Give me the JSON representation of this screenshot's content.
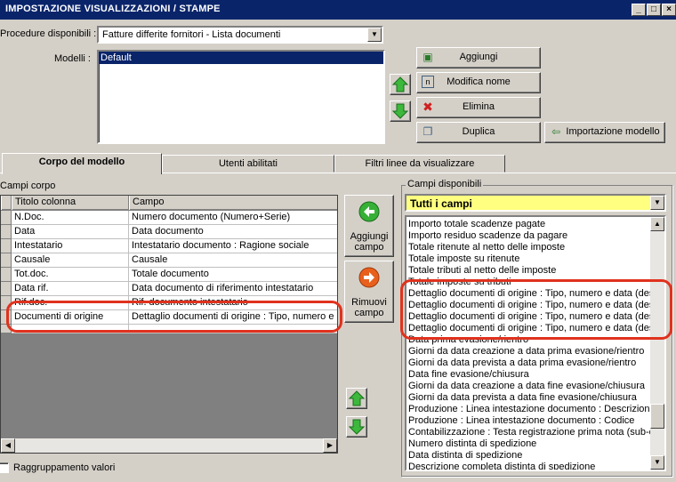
{
  "window": {
    "title": "IMPOSTAZIONE VISUALIZZAZIONI / STAMPE"
  },
  "procedure": {
    "label": "Procedure disponibili :",
    "value": "Fatture differite fornitori - Lista documenti"
  },
  "modelli": {
    "label": "Modelli :",
    "items": [
      "Default"
    ]
  },
  "buttons": {
    "aggiungi": "Aggiungi",
    "modifica_nome": "Modifica nome",
    "elimina": "Elimina",
    "duplica": "Duplica",
    "importazione": "Importazione modello",
    "aggiungi_campo": "Aggiungi campo",
    "rimuovi_campo": "Rimuovi campo"
  },
  "tabs": [
    {
      "label": "Corpo del modello",
      "active": true
    },
    {
      "label": "Utenti abilitati",
      "active": false
    },
    {
      "label": "Filtri linee da visualizzare",
      "active": false
    }
  ],
  "campi_corpo": {
    "title": "Campi corpo",
    "columns": [
      "Titolo colonna",
      "Campo"
    ],
    "rows": [
      {
        "titolo": "N.Doc.",
        "campo": "Numero documento (Numero+Serie)"
      },
      {
        "titolo": "Data",
        "campo": "Data documento"
      },
      {
        "titolo": "Intestatario",
        "campo": "Intestatario documento : Ragione sociale"
      },
      {
        "titolo": "Causale",
        "campo": "Causale"
      },
      {
        "titolo": "Tot.doc.",
        "campo": "Totale documento"
      },
      {
        "titolo": "Data rif.",
        "campo": "Data documento di riferimento intestatario"
      },
      {
        "titolo": "Rif.doc.",
        "campo": "Rif. documento intestatario"
      },
      {
        "titolo": "Documenti di origine",
        "campo": "Dettaglio documenti di origine : Tipo, numero e ..."
      }
    ]
  },
  "campi_disponibili": {
    "title": "Campi disponibili",
    "filter_value": "Tutti i campi",
    "items": [
      "Importo totale scadenze pagate",
      "Importo residuo scadenze da pagare",
      "Totale ritenute al netto delle imposte",
      "Totale imposte su ritenute",
      "Totale tributi al netto delle imposte",
      "Totale imposte su tributi",
      "Dettaglio documenti di origine : Tipo, numero e data (desc",
      "Dettaglio documenti di origine : Tipo, numero e data (desc",
      "Dettaglio documenti di origine : Tipo, numero e data (desc",
      "Dettaglio documenti di origine : Tipo, numero e data (desc",
      "Data prima evasione/rientro",
      "Giorni da data creazione a data prima evasione/rientro",
      "Giorni da data prevista a data prima evasione/rientro",
      "Data fine evasione/chiusura",
      "Giorni da data creazione a data fine evasione/chiusura",
      "Giorni da data prevista a data fine evasione/chiusura",
      "Produzione : Linea intestazione documento : Descrizione",
      "Produzione : Linea intestazione documento : Codice",
      "Contabilizzazione : Testa registrazione prima nota (sub-opz",
      "Numero distinta di spedizione",
      "Data distinta di spedizione",
      "Descrizione completa distinta di spedizione"
    ]
  },
  "raggruppamento": {
    "label": "Raggruppamento valori",
    "checked": false
  },
  "colors": {
    "title_bar": "#0a246a",
    "highlight": "#e0321e",
    "filter_bg": "#ffff80",
    "selection": "#0a246a"
  }
}
